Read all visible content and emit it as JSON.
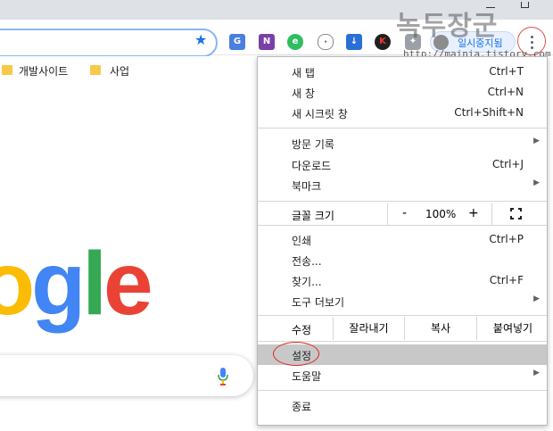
{
  "watermark": {
    "title": "녹두장군",
    "url": "http://mainia.tistory.com"
  },
  "toolbar": {
    "paused_label": "일시중지됨",
    "extensions": [
      "google-translate-icon",
      "onenote-icon",
      "evernote-icon",
      "mouse-icon",
      "download-icon",
      "k-icon",
      "puzzle-icon"
    ]
  },
  "bookmarks": {
    "items": [
      {
        "label": "개발사이트"
      },
      {
        "label": "사업"
      }
    ]
  },
  "google_logo": {
    "letters": [
      "o",
      "g",
      "l",
      "e"
    ],
    "colors": [
      "#fbbc05",
      "#4285f4",
      "#34a853",
      "#ea4335"
    ]
  },
  "menu": {
    "new_tab": {
      "label": "새 탭",
      "shortcut": "Ctrl+T"
    },
    "new_window": {
      "label": "새 창",
      "shortcut": "Ctrl+N"
    },
    "incognito": {
      "label": "새 시크릿 창",
      "shortcut": "Ctrl+Shift+N"
    },
    "history": {
      "label": "방문 기록"
    },
    "downloads": {
      "label": "다운로드",
      "shortcut": "Ctrl+J"
    },
    "bookmarks": {
      "label": "북마크"
    },
    "zoom": {
      "label": "글꼴 크기",
      "minus": "-",
      "value": "100%",
      "plus": "+"
    },
    "print": {
      "label": "인쇄",
      "shortcut": "Ctrl+P"
    },
    "cast": {
      "label": "전송..."
    },
    "find": {
      "label": "찾기...",
      "shortcut": "Ctrl+F"
    },
    "more_tools": {
      "label": "도구 더보기"
    },
    "edit": {
      "label": "수정",
      "cut": "잘라내기",
      "copy": "복사",
      "paste": "붙여넣기"
    },
    "settings": {
      "label": "설정"
    },
    "help": {
      "label": "도움말"
    },
    "exit": {
      "label": "종료"
    }
  },
  "colors": {
    "accent": "#1a73e8",
    "highlight": "#c8c8c8",
    "annotation": "#e02424"
  }
}
